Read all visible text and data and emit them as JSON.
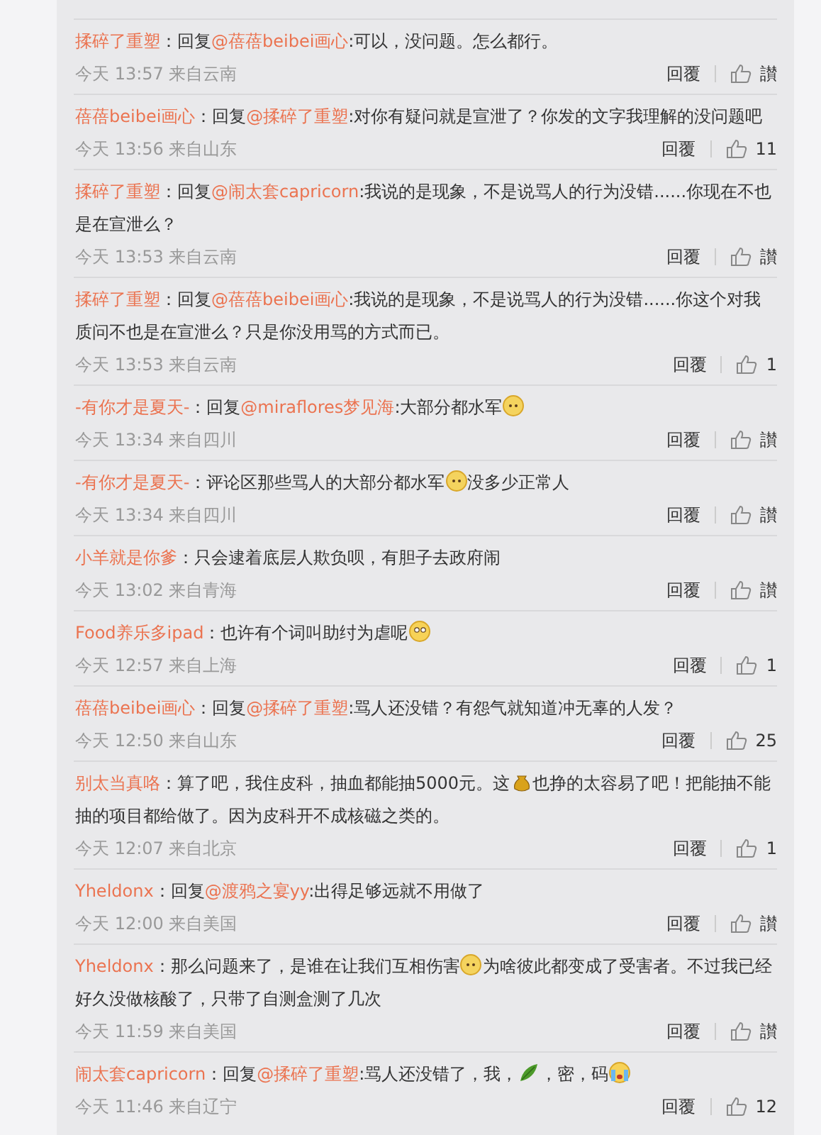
{
  "comments": [
    {
      "user": "揉碎了重塑",
      "segments": [
        {
          "kind": "text",
          "text": "：回复"
        },
        {
          "kind": "mention",
          "text": "@蓓蓓beibei画心"
        },
        {
          "kind": "text",
          "text": ":可以，没问题。怎么都行。"
        }
      ],
      "meta": "今天 13:57 来自云南",
      "reply": "回覆",
      "likes": "讃"
    },
    {
      "user": "蓓蓓beibei画心",
      "segments": [
        {
          "kind": "text",
          "text": "：回复"
        },
        {
          "kind": "mention",
          "text": "@揉碎了重塑"
        },
        {
          "kind": "text",
          "text": ":对你有疑问就是宣泄了？你发的文字我理解的没问题吧"
        }
      ],
      "meta": "今天 13:56 来自山东",
      "reply": "回覆",
      "likes": "11"
    },
    {
      "user": "揉碎了重塑",
      "segments": [
        {
          "kind": "text",
          "text": "：回复"
        },
        {
          "kind": "mention",
          "text": "@闹太套capricorn"
        },
        {
          "kind": "text",
          "text": ":我说的是现象，不是说骂人的行为没错......你现在不也是在宣泄么？"
        }
      ],
      "meta": "今天 13:53 来自云南",
      "reply": "回覆",
      "likes": "讃"
    },
    {
      "user": "揉碎了重塑",
      "segments": [
        {
          "kind": "text",
          "text": "：回复"
        },
        {
          "kind": "mention",
          "text": "@蓓蓓beibei画心"
        },
        {
          "kind": "text",
          "text": ":我说的是现象，不是说骂人的行为没错......你这个对我质问不也是在宣泄么？只是你没用骂的方式而已。"
        }
      ],
      "meta": "今天 13:53 来自云南",
      "reply": "回覆",
      "likes": "1"
    },
    {
      "user": "-有你才是夏天-",
      "segments": [
        {
          "kind": "text",
          "text": "：回复"
        },
        {
          "kind": "mention",
          "text": "@miraflores梦见海"
        },
        {
          "kind": "text",
          "text": ":大部分都水军"
        },
        {
          "kind": "dog"
        }
      ],
      "meta": "今天 13:34 来自四川",
      "reply": "回覆",
      "likes": "讃"
    },
    {
      "user": "-有你才是夏天-",
      "segments": [
        {
          "kind": "text",
          "text": "：评论区那些骂人的大部分都水军"
        },
        {
          "kind": "dog"
        },
        {
          "kind": "text",
          "text": "没多少正常人"
        }
      ],
      "meta": "今天 13:34 来自四川",
      "reply": "回覆",
      "likes": "讃"
    },
    {
      "user": "小羊就是你爹",
      "segments": [
        {
          "kind": "text",
          "text": "：只会逮着底层人欺负呗，有胆子去政府闹"
        }
      ],
      "meta": "今天 13:02 来自青海",
      "reply": "回覆",
      "likes": "讃"
    },
    {
      "user": "Food养乐多ipad",
      "segments": [
        {
          "kind": "text",
          "text": "：也许有个词叫助纣为虐呢"
        },
        {
          "kind": "thinking"
        }
      ],
      "meta": "今天 12:57 来自上海",
      "reply": "回覆",
      "likes": "1"
    },
    {
      "user": "蓓蓓beibei画心",
      "segments": [
        {
          "kind": "text",
          "text": "：回复"
        },
        {
          "kind": "mention",
          "text": "@揉碎了重塑"
        },
        {
          "kind": "text",
          "text": ":骂人还没错？有怨气就知道冲无辜的人发？"
        }
      ],
      "meta": "今天 12:50 来自山东",
      "reply": "回覆",
      "likes": "25"
    },
    {
      "user": "别太当真咯",
      "segments": [
        {
          "kind": "text",
          "text": "：算了吧，我住皮科，抽血都能抽5000元。这"
        },
        {
          "kind": "money"
        },
        {
          "kind": "text",
          "text": "也挣的太容易了吧！把能抽不能抽的项目都给做了。因为皮科开不成核磁之类的。"
        }
      ],
      "meta": "今天 12:07 来自北京",
      "reply": "回覆",
      "likes": "1"
    },
    {
      "user": "Yheldonx",
      "segments": [
        {
          "kind": "text",
          "text": "：回复"
        },
        {
          "kind": "mention",
          "text": "@渡鸦之宴yy"
        },
        {
          "kind": "text",
          "text": ":出得足够远就不用做了"
        }
      ],
      "meta": "今天 12:00 来自美国",
      "reply": "回覆",
      "likes": "讃"
    },
    {
      "user": "Yheldonx",
      "segments": [
        {
          "kind": "text",
          "text": "：那么问题来了，是谁在让我们互相伤害"
        },
        {
          "kind": "dog"
        },
        {
          "kind": "text",
          "text": "为啥彼此都变成了受害者。不过我已经好久没做核酸了，只带了自测盒测了几次"
        }
      ],
      "meta": "今天 11:59 来自美国",
      "reply": "回覆",
      "likes": "讃"
    },
    {
      "user": "闹太套capricorn",
      "segments": [
        {
          "kind": "text",
          "text": "：回复"
        },
        {
          "kind": "mention",
          "text": "@揉碎了重塑"
        },
        {
          "kind": "text",
          "text": ":骂人还没错了，我，"
        },
        {
          "kind": "leaf"
        },
        {
          "kind": "text",
          "text": "，密，码"
        },
        {
          "kind": "crying"
        }
      ],
      "meta": "今天 11:46 来自辽宁",
      "reply": "回覆",
      "likes": "12"
    }
  ]
}
